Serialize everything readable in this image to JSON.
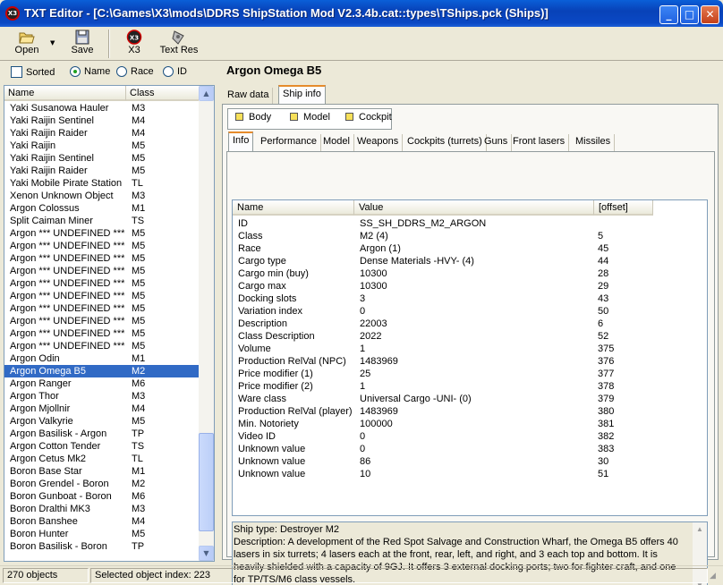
{
  "window": {
    "title": "TXT Editor - [C:\\Games\\X3\\mods\\DDRS ShipStation Mod V2.3.4b.cat::types\\TShips.pck (Ships)]",
    "app_icon_text": "X3",
    "minimize": "_",
    "maximize": "□",
    "close": "✕"
  },
  "toolbar": {
    "open_label": "Open",
    "save_label": "Save",
    "x3_label": "X3",
    "textres_label": "Text Res"
  },
  "filters": {
    "sorted_label": "Sorted",
    "name_label": "Name",
    "race_label": "Race",
    "id_label": "ID",
    "selected": "Name"
  },
  "list": {
    "columns": [
      "Name",
      "Class"
    ],
    "rows": [
      [
        "Yaki Susanowa Hauler",
        "M3"
      ],
      [
        "Yaki Raijin Sentinel",
        "M4"
      ],
      [
        "Yaki Raijin Raider",
        "M4"
      ],
      [
        "Yaki Raijin",
        "M5"
      ],
      [
        "Yaki Raijin Sentinel",
        "M5"
      ],
      [
        "Yaki Raijin Raider",
        "M5"
      ],
      [
        "Yaki Mobile Pirate Station",
        "TL"
      ],
      [
        "Xenon Unknown Object",
        "M3"
      ],
      [
        "Argon Colossus",
        "M1"
      ],
      [
        "Split Caiman Miner",
        "TS"
      ],
      [
        "Argon *** UNDEFINED ***",
        "M5"
      ],
      [
        "Argon *** UNDEFINED ***",
        "M5"
      ],
      [
        "Argon *** UNDEFINED ***",
        "M5"
      ],
      [
        "Argon *** UNDEFINED ***",
        "M5"
      ],
      [
        "Argon *** UNDEFINED ***",
        "M5"
      ],
      [
        "Argon *** UNDEFINED ***",
        "M5"
      ],
      [
        "Argon *** UNDEFINED ***",
        "M5"
      ],
      [
        "Argon *** UNDEFINED ***",
        "M5"
      ],
      [
        "Argon *** UNDEFINED ***",
        "M5"
      ],
      [
        "Argon *** UNDEFINED ***",
        "M5"
      ],
      [
        "Argon Odin",
        "M1"
      ],
      [
        "Argon Omega B5",
        "M2"
      ],
      [
        "Argon Ranger",
        "M6"
      ],
      [
        "Argon Thor",
        "M3"
      ],
      [
        "Argon Mjollnir",
        "M4"
      ],
      [
        "Argon Valkyrie",
        "M5"
      ],
      [
        "Argon Basilisk - Argon",
        "TP"
      ],
      [
        "Argon Cotton Tender",
        "TS"
      ],
      [
        "Argon Cetus Mk2",
        "TL"
      ],
      [
        "Boron Base Star",
        "M1"
      ],
      [
        "Boron Grendel - Boron",
        "M2"
      ],
      [
        "Boron Gunboat - Boron",
        "M6"
      ],
      [
        "Boron Dralthi MK3",
        "M3"
      ],
      [
        "Boron Banshee",
        "M4"
      ],
      [
        "Boron Hunter",
        "M5"
      ],
      [
        "Boron Basilisk - Boron",
        "TP"
      ]
    ],
    "selected_index": 21
  },
  "ship_title": "Argon Omega B5",
  "tabs_main": [
    "Raw data",
    "Ship info"
  ],
  "tabs_main_active": 1,
  "subtabs": [
    "Body",
    "Model",
    "Cockpit"
  ],
  "tabs_info": [
    "Info",
    "Performance",
    "Model",
    "Weapons",
    "Cockpits (turrets)",
    "Guns",
    "Front lasers",
    "Missiles"
  ],
  "tabs_info_active": 0,
  "grid": {
    "columns": [
      "Name",
      "Value",
      "[offset]"
    ],
    "rows": [
      [
        "ID",
        "SS_SH_DDRS_M2_ARGON",
        ""
      ],
      [
        "Class",
        "M2 (4)",
        "5"
      ],
      [
        "Race",
        "Argon (1)",
        "45"
      ],
      [
        "Cargo type",
        "Dense Materials -HVY- (4)",
        "44"
      ],
      [
        "Cargo min (buy)",
        "10300",
        "28"
      ],
      [
        "Cargo max",
        "10300",
        "29"
      ],
      [
        "Docking slots",
        "3",
        "43"
      ],
      [
        "Variation index",
        "0",
        "50"
      ],
      [
        "Description",
        "22003",
        "6"
      ],
      [
        "Class Description",
        "2022",
        "52"
      ],
      [
        "Volume",
        "1",
        "375"
      ],
      [
        "Production RelVal (NPC)",
        "1483969",
        "376"
      ],
      [
        "Price modifier (1)",
        "25",
        "377"
      ],
      [
        "Price modifier (2)",
        "1",
        "378"
      ],
      [
        "Ware class",
        "Universal Cargo -UNI- (0)",
        "379"
      ],
      [
        "Production RelVal (player)",
        "1483969",
        "380"
      ],
      [
        "Min. Notoriety",
        "100000",
        "381"
      ],
      [
        "Video ID",
        "0",
        "382"
      ],
      [
        "Unknown value",
        "0",
        "383"
      ],
      [
        "Unknown value",
        "86",
        "30"
      ],
      [
        "Unknown value",
        "10",
        "51"
      ]
    ]
  },
  "description": {
    "line1": "Ship type: Destroyer M2",
    "line2": "Description: A development of the Red Spot Salvage and Construction Wharf, the Omega B5 offers 40 lasers in six turrets; 4 lasers each at the front, rear, left, and right, and 3 each top and bottom. It is heavily shielded with a capacity of 9GJ. It offers 3 external docking ports; two for fighter craft, and one for TP/TS/M6 class vessels."
  },
  "status": {
    "count": "270 objects",
    "selected": "Selected object index: 223"
  }
}
